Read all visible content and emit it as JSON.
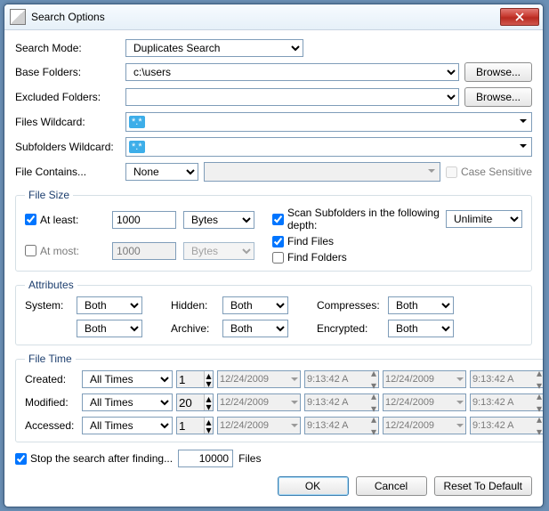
{
  "window": {
    "title": "Search Options"
  },
  "labels": {
    "search_mode": "Search Mode:",
    "base_folders": "Base Folders:",
    "excluded_folders": "Excluded Folders:",
    "files_wildcard": "Files Wildcard:",
    "subfolders_wildcard": "Subfolders Wildcard:",
    "file_contains": "File Contains...",
    "case_sensitive": "Case Sensitive",
    "file_size_group": "File Size",
    "at_least": "At least:",
    "at_most": "At most:",
    "scan_subfolders": "Scan Subfolders in the following depth:",
    "find_files": "Find Files",
    "find_folders": "Find Folders",
    "attributes_group": "Attributes",
    "system": "System:",
    "hidden": "Hidden:",
    "compresses": "Compresses:",
    "archive": "Archive:",
    "encrypted": "Encrypted:",
    "file_time_group": "File Time",
    "created": "Created:",
    "modified": "Modified:",
    "accessed": "Accessed:",
    "stop_after": "Stop the search after finding...",
    "files_suffix": "Files",
    "browse": "Browse...",
    "ok": "OK",
    "cancel": "Cancel",
    "reset": "Reset To Default"
  },
  "values": {
    "search_mode": "Duplicates Search",
    "base_folders": "c:\\users",
    "excluded_folders": "",
    "files_wildcard_chip": "*.*",
    "subfolders_wildcard_chip": "*.*",
    "file_contains_mode": "None",
    "file_contains_text": "",
    "case_sensitive": false,
    "at_least_checked": true,
    "at_least_value": "1000",
    "at_least_unit": "Bytes",
    "at_most_checked": false,
    "at_most_value": "1000",
    "at_most_unit": "Bytes",
    "scan_subfolders_checked": true,
    "depth": "Unlimited",
    "find_files": true,
    "find_folders": false,
    "attr_system": "Both",
    "attr_hidden": "Both",
    "attr_compresses": "Both",
    "attr_readonly": "Both",
    "attr_archive": "Both",
    "attr_encrypted": "Both",
    "created_mode": "All Times",
    "created_n": "1",
    "created_date1": "12/24/2009",
    "created_time1": "9:13:42 A",
    "created_date2": "12/24/2009",
    "created_time2": "9:13:42 A",
    "modified_mode": "All Times",
    "modified_n": "20",
    "modified_date1": "12/24/2009",
    "modified_time1": "9:13:42 A",
    "modified_date2": "12/24/2009",
    "modified_time2": "9:13:42 A",
    "accessed_mode": "All Times",
    "accessed_n": "1",
    "accessed_date1": "12/24/2009",
    "accessed_time1": "9:13:42 A",
    "accessed_date2": "12/24/2009",
    "accessed_time2": "9:13:42 A",
    "stop_after_checked": true,
    "stop_after_value": "10000"
  }
}
